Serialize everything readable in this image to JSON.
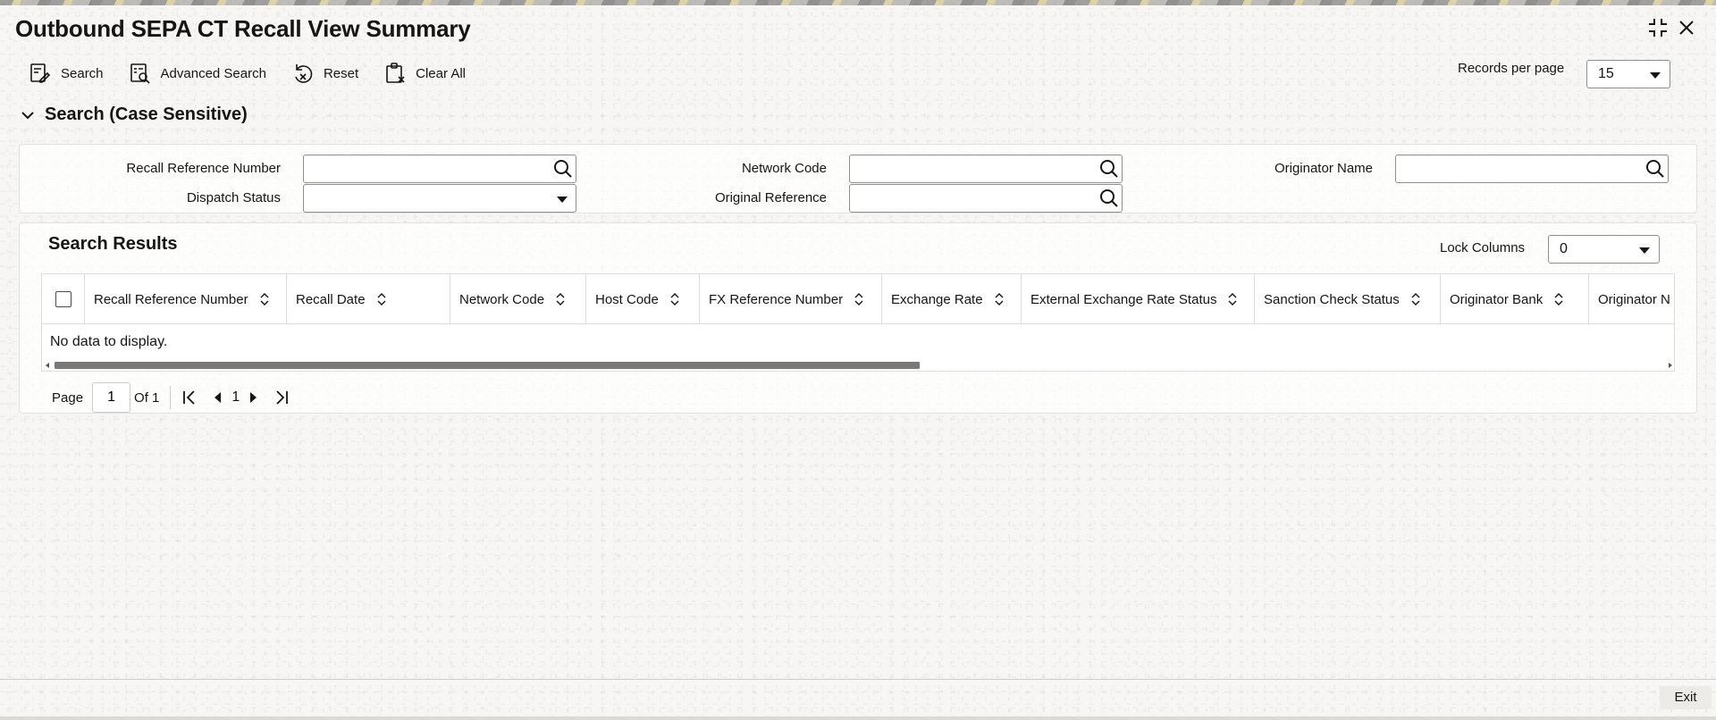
{
  "window": {
    "title": "Outbound SEPA CT Recall View Summary"
  },
  "toolbar": {
    "search_label": "Search",
    "advanced_search_label": "Advanced Search",
    "reset_label": "Reset",
    "clear_all_label": "Clear All"
  },
  "records_per_page": {
    "label": "Records per page",
    "value": "15"
  },
  "search_section": {
    "title": "Search (Case Sensitive)",
    "fields": {
      "recall_reference_number": {
        "label": "Recall Reference Number",
        "value": ""
      },
      "network_code": {
        "label": "Network Code",
        "value": ""
      },
      "originator_name": {
        "label": "Originator Name",
        "value": ""
      },
      "dispatch_status": {
        "label": "Dispatch Status",
        "value": ""
      },
      "original_reference": {
        "label": "Original Reference",
        "value": ""
      }
    }
  },
  "results": {
    "title": "Search Results",
    "lock_columns_label": "Lock Columns",
    "lock_columns_value": "0",
    "columns": [
      "Recall Reference Number",
      "Recall Date",
      "Network Code",
      "Host Code",
      "FX Reference Number",
      "Exchange Rate",
      "External Exchange Rate Status",
      "Sanction Check Status",
      "Originator Bank",
      "Originator N"
    ],
    "empty_text": "No data to display."
  },
  "pagination": {
    "page_label": "Page",
    "current_page": "1",
    "of_label": "Of 1",
    "page_number": "1"
  },
  "footer": {
    "exit_label": "Exit"
  }
}
